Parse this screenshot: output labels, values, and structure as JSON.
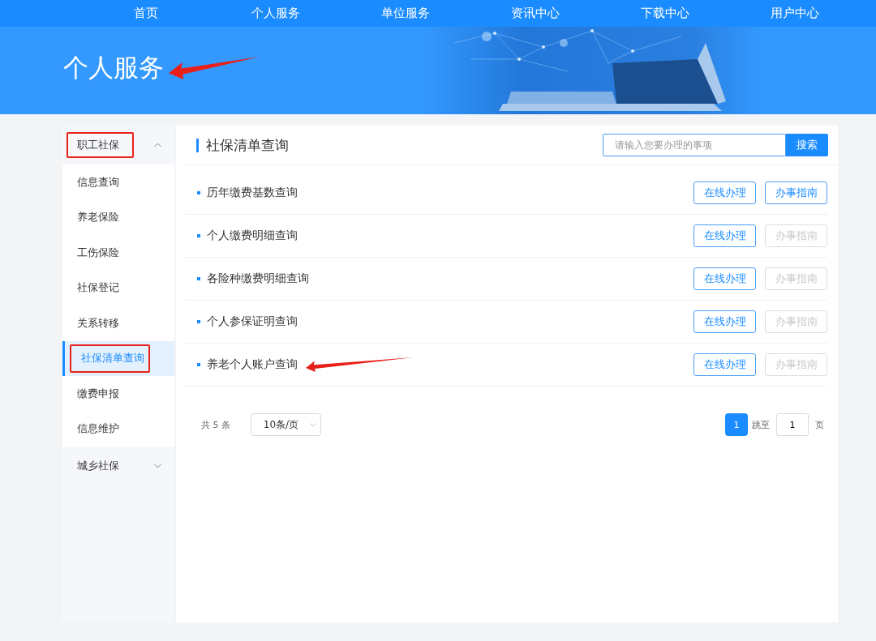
{
  "nav": {
    "items": [
      {
        "label": "首页"
      },
      {
        "label": "个人服务"
      },
      {
        "label": "单位服务"
      },
      {
        "label": "资讯中心"
      },
      {
        "label": "下载中心"
      },
      {
        "label": "用户中心"
      }
    ]
  },
  "banner": {
    "title": "个人服务",
    "annotated": true
  },
  "sidebar": {
    "groups": [
      {
        "label": "职工社保",
        "expanded": true,
        "highlighted": true,
        "children": [
          {
            "label": "信息查询",
            "selected": false,
            "highlighted": false
          },
          {
            "label": "养老保险",
            "selected": false,
            "highlighted": false
          },
          {
            "label": "工伤保险",
            "selected": false,
            "highlighted": false
          },
          {
            "label": "社保登记",
            "selected": false,
            "highlighted": false
          },
          {
            "label": "关系转移",
            "selected": false,
            "highlighted": false
          },
          {
            "label": "社保清单查询",
            "selected": true,
            "highlighted": true
          },
          {
            "label": "缴费申报",
            "selected": false,
            "highlighted": false
          },
          {
            "label": "信息维护",
            "selected": false,
            "highlighted": false
          }
        ]
      },
      {
        "label": "城乡社保",
        "expanded": false,
        "highlighted": false
      }
    ]
  },
  "panel": {
    "title": "社保清单查询",
    "search": {
      "placeholder": "请输入您要办理的事项",
      "button": "搜索"
    },
    "rows": [
      {
        "label": "历年缴费基数查询",
        "online": "在线办理",
        "guide": "办事指南",
        "guide_disabled": false,
        "annotated": false
      },
      {
        "label": "个人缴费明细查询",
        "online": "在线办理",
        "guide": "办事指南",
        "guide_disabled": true,
        "annotated": false
      },
      {
        "label": "各险种缴费明细查询",
        "online": "在线办理",
        "guide": "办事指南",
        "guide_disabled": true,
        "annotated": false
      },
      {
        "label": "个人参保证明查询",
        "online": "在线办理",
        "guide": "办事指南",
        "guide_disabled": true,
        "annotated": false
      },
      {
        "label": "养老个人账户查询",
        "online": "在线办理",
        "guide": "办事指南",
        "guide_disabled": true,
        "annotated": true
      }
    ],
    "pagination": {
      "total": "共 5 条",
      "page_size": "10条/页",
      "pages": [
        {
          "label": "1",
          "selected": true
        }
      ],
      "jump_label": "跳至",
      "jump_value": "1",
      "page_unit": "页"
    }
  }
}
